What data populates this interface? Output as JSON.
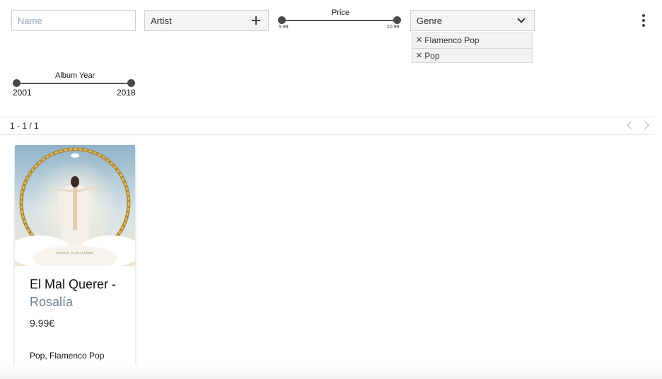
{
  "filters": {
    "name": {
      "placeholder": "Name",
      "value": ""
    },
    "artist": {
      "label": "Artist"
    },
    "price": {
      "title": "Price",
      "min": "5.99",
      "max": "10.99"
    },
    "genre": {
      "label": "Genre",
      "selected": [
        "Flamenco Pop",
        "Pop"
      ]
    },
    "album_year": {
      "title": "Album Year",
      "min": "2001",
      "max": "2018"
    }
  },
  "pagination": {
    "text": "1 - 1 / 1"
  },
  "results": [
    {
      "title": "El Mal Querer -",
      "artist": "Rosalía",
      "price": "9.99€",
      "genres": "Pop, Flamenco Pop",
      "cover_caption": "ROSALÍA · EL MAL QUERER"
    }
  ],
  "icons": {
    "artist_add": "plus-icon",
    "genre_toggle": "chevron-down-icon",
    "chip_remove": "close-icon",
    "menu": "more-vert-icon",
    "prev": "chevron-left-icon",
    "next": "chevron-right-icon"
  },
  "colors": {
    "artist_text": "#6e7f92",
    "slider_knob": "#4a4a4a",
    "chip_bg": "#f2f2f2"
  }
}
